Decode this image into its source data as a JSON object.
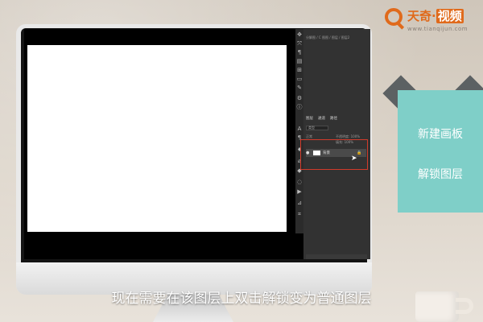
{
  "logo": {
    "brand_main": "天奇·",
    "brand_tail": "视频",
    "url": "www.tianqijun.com"
  },
  "side_card": {
    "items": [
      "新建画板",
      "解锁图层"
    ]
  },
  "subtitle": "现在需要在该图层上双击解锁变为普通图层",
  "photoshop": {
    "history_text": "分解图 / C 图图 / 图层 / 图层2",
    "panel_tabs": [
      "图层",
      "通道",
      "路径"
    ],
    "filter_label": "类型",
    "blend_mode": "正常",
    "opacity_label": "不透明度: 100%",
    "fill_label": "填充: 100%",
    "layer_name": "背景"
  },
  "colors": {
    "accent": "#e06a1b",
    "highlight_box": "#d03b2b",
    "card": "#7fcfc8"
  }
}
